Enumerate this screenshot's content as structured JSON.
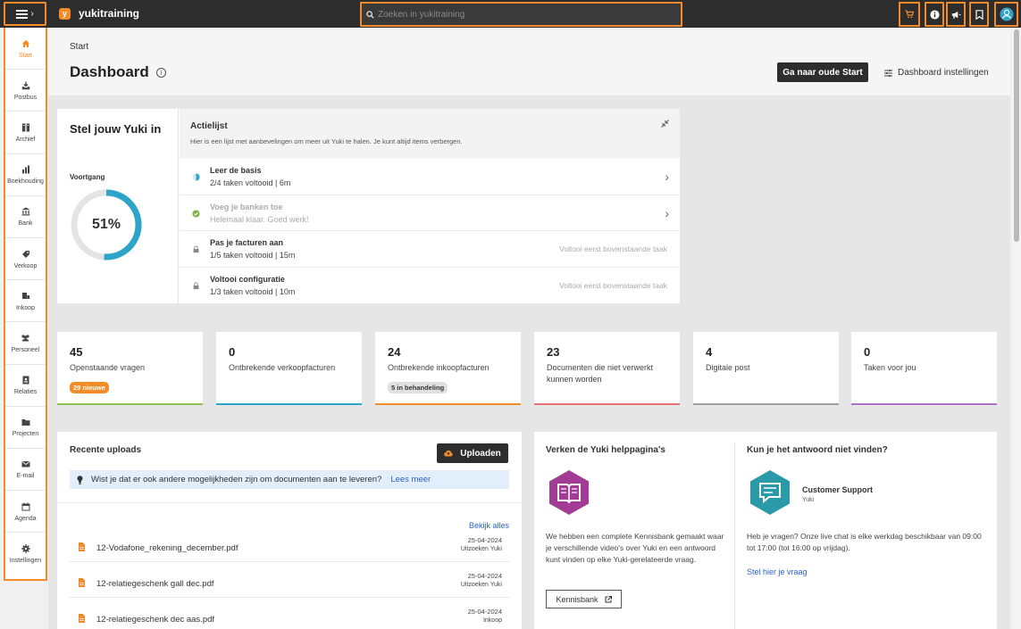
{
  "topbar": {
    "brand_logo_letter": "y",
    "brand_name": "yukitraining",
    "search_placeholder": "Zoeken in yukitraining",
    "icons": [
      "cart-icon",
      "info-icon",
      "megaphone-icon",
      "bookmark-icon",
      "user-icon"
    ]
  },
  "sidebar": {
    "items": [
      {
        "label": "Start",
        "icon": "home-icon",
        "active": true
      },
      {
        "label": "Postbus",
        "icon": "inbox-icon"
      },
      {
        "label": "Archief",
        "icon": "archive-icon"
      },
      {
        "label": "Boekhouding",
        "icon": "bar-chart-icon"
      },
      {
        "label": "Bank",
        "icon": "bank-icon"
      },
      {
        "label": "Verkoop",
        "icon": "tag-icon"
      },
      {
        "label": "Inkoop",
        "icon": "cart-icon"
      },
      {
        "label": "Personeel",
        "icon": "people-icon"
      },
      {
        "label": "Relaties",
        "icon": "contact-icon"
      },
      {
        "label": "Projecten",
        "icon": "folder-icon"
      },
      {
        "label": "E-mail",
        "icon": "mail-icon"
      },
      {
        "label": "Agenda",
        "icon": "calendar-icon"
      },
      {
        "label": "Instellingen",
        "icon": "gear-icon"
      }
    ]
  },
  "header": {
    "breadcrumb": "Start",
    "title": "Dashboard",
    "old_start_button": "Ga naar oude Start",
    "settings_link": "Dashboard instellingen"
  },
  "setup": {
    "title": "Stel jouw Yuki in",
    "progress_label": "Voortgang",
    "progress_value": 51,
    "progress_text": "51%",
    "actielijst_title": "Actielijst",
    "actielijst_sub": "Hier is een lijst met aanbevelingen om meer uit Yuki te halen. Je kunt altijd items verbergen.",
    "tasks": [
      {
        "name": "Leer de basis",
        "sub": "2/4 taken voltooid | 6m",
        "status": "open"
      },
      {
        "name": "Voeg je banken toe",
        "sub": "Helemaal klaar. Goed werk!",
        "status": "done"
      },
      {
        "name": "Pas je facturen aan",
        "sub": "1/5 taken voltooid | 15m",
        "status": "locked",
        "lock_text": "Voltooi eerst bovenstaande taak"
      },
      {
        "name": "Voltooi configuratie",
        "sub": "1/3 taken voltooid | 10m",
        "status": "locked",
        "lock_text": "Voltooi eerst bovenstaande taak"
      }
    ]
  },
  "stats": [
    {
      "value": "45",
      "label": "Openstaande vragen",
      "badge": "29 nieuwe",
      "color": "#8bc34a"
    },
    {
      "value": "0",
      "label": "Ontbrekende verkoopfacturen",
      "color": "#2fa4c9"
    },
    {
      "value": "24",
      "label": "Ontbrekende inkoopfacturen",
      "badge": "5 in behandeling",
      "color": "#f28c28"
    },
    {
      "value": "23",
      "label": "Documenten die niet verwerkt kunnen worden",
      "color": "#e57373"
    },
    {
      "value": "4",
      "label": "Digitale post",
      "color": "#9e9e9e"
    },
    {
      "value": "0",
      "label": "Taken voor jou",
      "color": "#b070c8"
    }
  ],
  "uploads": {
    "title": "Recente uploads",
    "upload_button": "Uploaden",
    "info_text": "Wist je dat er ook andere mogelijkheden zijn om documenten aan te leveren?",
    "info_link": "Lees meer",
    "view_all": "Bekijk alles",
    "files": [
      {
        "name": "12-Vodafone_rekening_december.pdf",
        "date": "25-04-2024",
        "status": "Uitzoeken Yuki"
      },
      {
        "name": "12-relatiegeschenk gall dec.pdf",
        "date": "25-04-2024",
        "status": "Uitzoeken Yuki"
      },
      {
        "name": "12-relatiegeschenk dec aas.pdf",
        "date": "25-04-2024",
        "status": "Inkoop"
      }
    ]
  },
  "help": {
    "left_title": "Verken de Yuki helppagina's",
    "left_text": "We hebben een complete Kennisbank gemaakt waar je verschillende video's over Yuki en een antwoord kunt vinden op elke Yuki-gerelateerde vraag.",
    "kb_button": "Kennisbank",
    "right_title": "Kun je het antwoord niet vinden?",
    "cs_name": "Customer Support",
    "cs_sub": "Yuki",
    "right_text": "Heb je vragen? Onze live chat is elke werkdag beschikbaar van 09:00 tot 17:00 (tot 16:00 op vrijdag).",
    "ask_link": "Stel hier je vraag"
  },
  "colors": {
    "accent": "#f28c28",
    "ring": "#2fa4c9",
    "link": "#2a63c9",
    "kb_hex": "#a23b94",
    "cs_hex": "#2a9aa8"
  }
}
